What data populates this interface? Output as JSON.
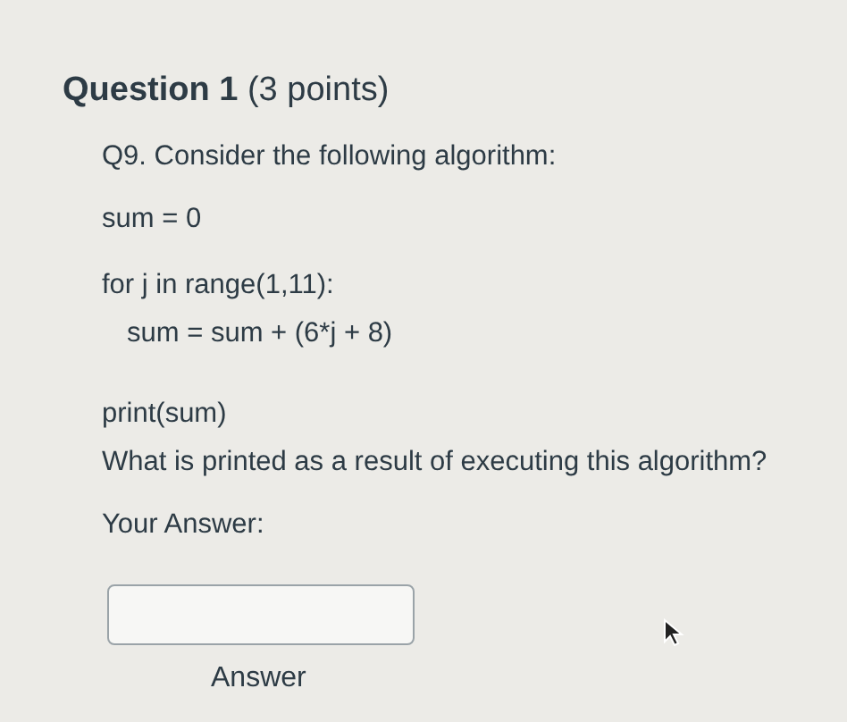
{
  "question": {
    "title": "Question 1",
    "points": "(3 points)"
  },
  "lines": [
    {
      "kind": "text",
      "text": "Q9. Consider the following algorithm:"
    },
    {
      "kind": "code",
      "text": "sum = 0"
    },
    {
      "kind": "gap"
    },
    {
      "kind": "code",
      "text": "for j in range(1,11):"
    },
    {
      "kind": "code-indent",
      "text": "sum = sum + (6*j + 8)"
    },
    {
      "kind": "gap"
    },
    {
      "kind": "code",
      "text": "print(sum)"
    },
    {
      "kind": "text",
      "text": "What is printed as a result of executing this algorithm?"
    }
  ],
  "answer": {
    "prompt": "Your Answer:",
    "caption": "Answer"
  }
}
